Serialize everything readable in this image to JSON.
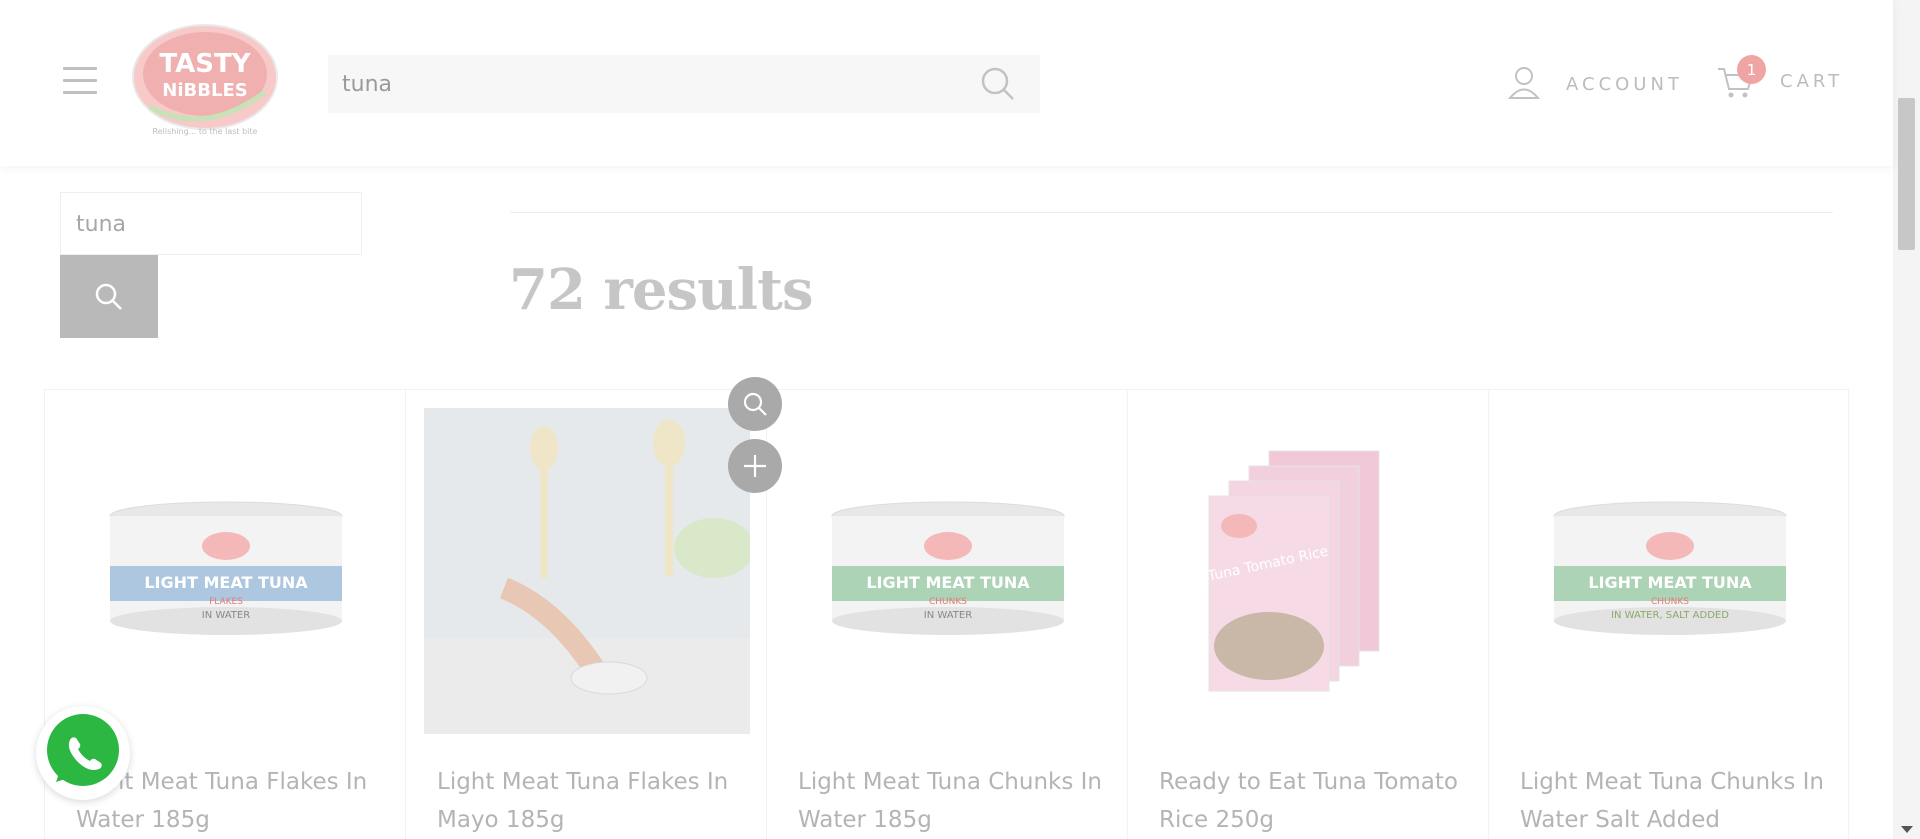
{
  "header": {
    "logo_text_line1": "TASTY",
    "logo_text_line2": "NiBBLES",
    "logo_tagline": "Relishing... to the last bite",
    "search_value": "tuna",
    "account_label": "ACCOUNT",
    "cart_label": "CART",
    "cart_count": "1"
  },
  "sidebar": {
    "search_value": "tuna"
  },
  "results": {
    "title": "72 results"
  },
  "products": [
    {
      "title": "Light Meat Tuna Flakes In Water 185g",
      "can_label": "LIGHT MEAT TUNA",
      "can_sub": "FLAKES",
      "can_note": "IN WATER",
      "band_color": "#8db4d6"
    },
    {
      "title": "Light Meat Tuna Flakes In Mayo 185g"
    },
    {
      "title": "Light Meat Tuna Chunks In Water 185g",
      "can_label": "LIGHT MEAT TUNA",
      "can_sub": "CHUNKS",
      "can_note": "IN WATER",
      "band_color": "#8dc49a"
    },
    {
      "title": "Ready to Eat Tuna Tomato Rice 250g",
      "pack_label": "Tuna Tomato Rice"
    },
    {
      "title": "Light Meat Tuna Chunks In Water Salt Added",
      "can_label": "LIGHT MEAT TUNA",
      "can_sub": "CHUNKS",
      "can_note": "IN WATER, SALT ADDED",
      "band_color": "#8dc49a"
    }
  ],
  "colors": {
    "accent_pink": "#f0a5a5",
    "muted_text": "#b4b4b4"
  },
  "icons": [
    "hamburger-menu-icon",
    "search-icon",
    "user-icon",
    "cart-icon",
    "zoom-icon",
    "plus-icon",
    "whatsapp-icon"
  ]
}
